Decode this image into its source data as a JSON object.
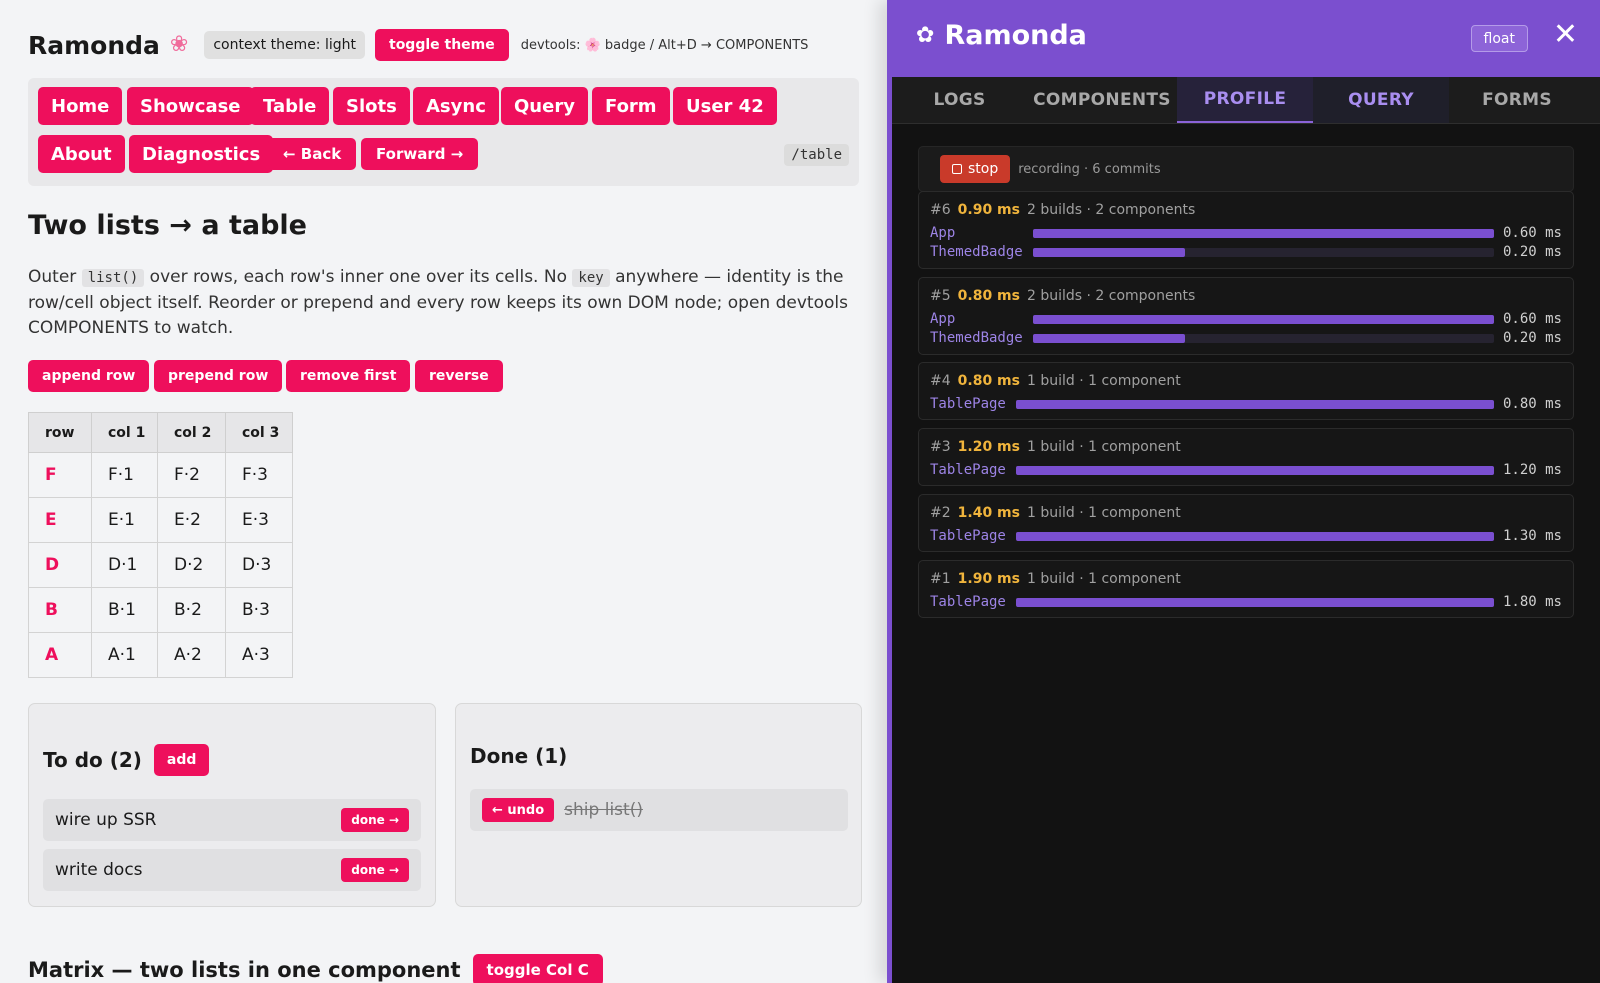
{
  "app": {
    "title": "Ramonda",
    "flower_icon": "sakura-icon",
    "theme_chip": "context theme: light",
    "toggle_theme": "toggle theme",
    "devtools_hint": "devtools: 🌸 badge / Alt+D → COMPONENTS"
  },
  "nav": {
    "items": [
      "Home",
      "Showcase",
      "Table",
      "Slots",
      "Async",
      "Query",
      "Form",
      "User 42",
      "About",
      "Diagnostics"
    ],
    "back": "← Back",
    "forward": "Forward →",
    "route": "/table"
  },
  "page": {
    "heading": "Two lists → a table",
    "para_1": "Outer ",
    "code_1": "list()",
    "para_2": " over rows, each row's inner one over its cells. No ",
    "code_2": "key",
    "para_3": " anywhere — identity is the row/cell object itself. Reorder or prepend and every row keeps its own DOM node; open devtools COMPONENTS to watch.",
    "actions": [
      "append row",
      "prepend row",
      "remove first",
      "reverse"
    ]
  },
  "table": {
    "headers": [
      "row",
      "col 1",
      "col 2",
      "col 3"
    ],
    "rows": [
      [
        "F",
        "F·1",
        "F·2",
        "F·3"
      ],
      [
        "E",
        "E·1",
        "E·2",
        "E·3"
      ],
      [
        "D",
        "D·1",
        "D·2",
        "D·3"
      ],
      [
        "B",
        "B·1",
        "B·2",
        "B·3"
      ],
      [
        "A",
        "A·1",
        "A·2",
        "A·3"
      ]
    ]
  },
  "todo": {
    "title": "To do (2)",
    "add": "add",
    "items": [
      {
        "text": "wire up SSR",
        "action": "done →"
      },
      {
        "text": "write docs",
        "action": "done →"
      }
    ]
  },
  "done": {
    "title": "Done (1)",
    "undo": "← undo",
    "item": "ship list()"
  },
  "matrix": {
    "heading": "Matrix — two lists in one component",
    "toggle": "toggle Col C"
  },
  "devtools": {
    "title": "Ramonda",
    "float": "float",
    "tabs": [
      "LOGS",
      "COMPONENTS",
      "PROFILE",
      "QUERY",
      "FORMS"
    ],
    "active_tab": "PROFILE",
    "stop": "stop",
    "recording": "recording · 6 commits",
    "accent": "#7b4fcf",
    "commits": [
      {
        "id": "#6",
        "ms": "0.90 ms",
        "summary": "2 builds · 2 components",
        "components": [
          {
            "name": "App",
            "ms": "0.60 ms",
            "frac": 1.0
          },
          {
            "name": "ThemedBadge",
            "ms": "0.20 ms",
            "frac": 0.33
          }
        ]
      },
      {
        "id": "#5",
        "ms": "0.80 ms",
        "summary": "2 builds · 2 components",
        "components": [
          {
            "name": "App",
            "ms": "0.60 ms",
            "frac": 1.0
          },
          {
            "name": "ThemedBadge",
            "ms": "0.20 ms",
            "frac": 0.33
          }
        ]
      },
      {
        "id": "#4",
        "ms": "0.80 ms",
        "summary": "1 build · 1 component",
        "components": [
          {
            "name": "TablePage",
            "ms": "0.80 ms",
            "frac": 1.0
          }
        ]
      },
      {
        "id": "#3",
        "ms": "1.20 ms",
        "summary": "1 build · 1 component",
        "components": [
          {
            "name": "TablePage",
            "ms": "1.20 ms",
            "frac": 1.0
          }
        ]
      },
      {
        "id": "#2",
        "ms": "1.40 ms",
        "summary": "1 build · 1 component",
        "components": [
          {
            "name": "TablePage",
            "ms": "1.30 ms",
            "frac": 1.0
          }
        ]
      },
      {
        "id": "#1",
        "ms": "1.90 ms",
        "summary": "1 build · 1 component",
        "components": [
          {
            "name": "TablePage",
            "ms": "1.80 ms",
            "frac": 1.0
          }
        ]
      }
    ]
  }
}
